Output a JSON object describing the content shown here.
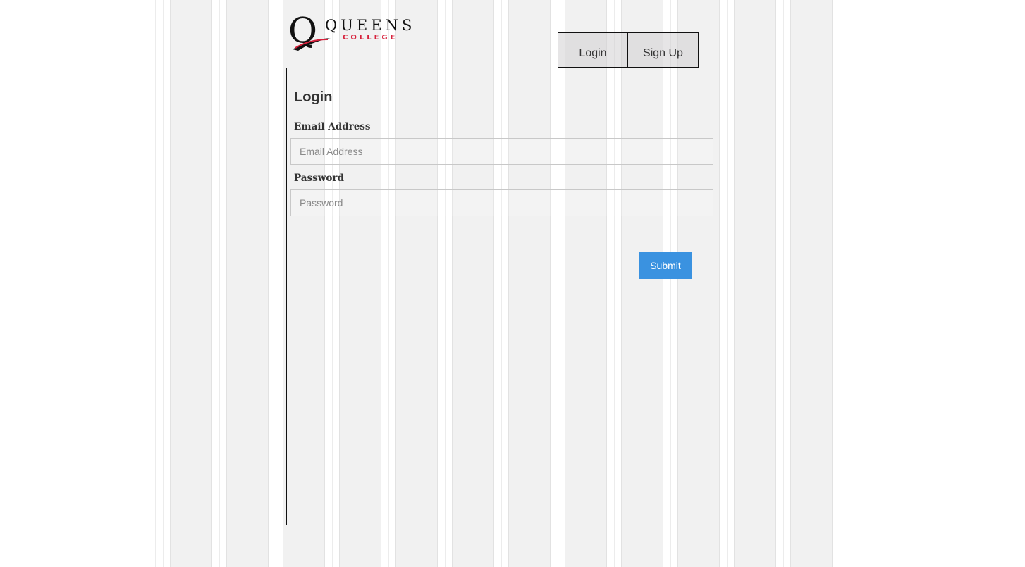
{
  "brand": {
    "logo_word": "QUEENS",
    "logo_subword": "COLLEGE",
    "logo_letter": "Q",
    "accent_color": "#d61f3a"
  },
  "tabs": [
    {
      "label": "Login",
      "active": true
    },
    {
      "label": "Sign Up",
      "active": false
    }
  ],
  "form": {
    "title": "Login",
    "email": {
      "label": "Email Address",
      "placeholder": "Email Address",
      "value": ""
    },
    "password": {
      "label": "Password",
      "placeholder": "Password",
      "value": ""
    },
    "submit_label": "Submit",
    "submit_color": "#3a92e0"
  }
}
